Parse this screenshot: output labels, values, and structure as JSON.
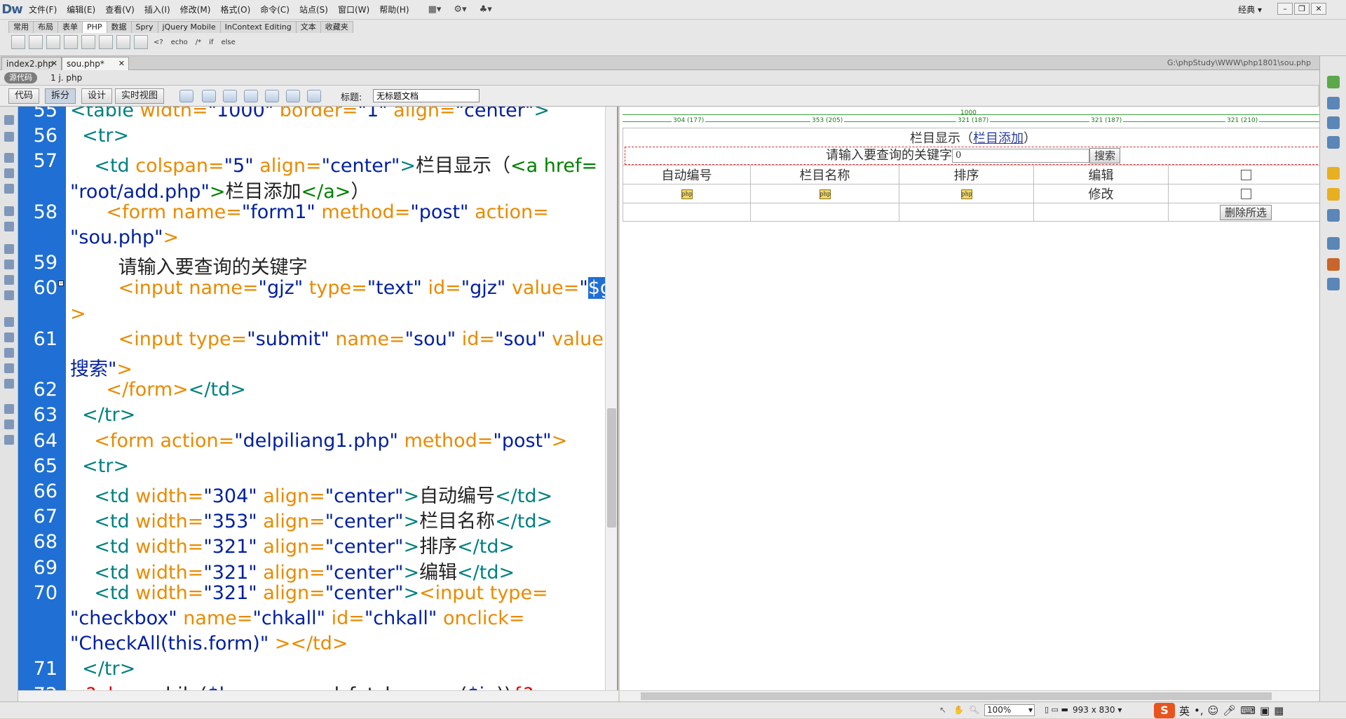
{
  "app": {
    "logo": "Dw",
    "layout_mode": "经典"
  },
  "menu": [
    "文件(F)",
    "编辑(E)",
    "查看(V)",
    "插入(I)",
    "修改(M)",
    "格式(O)",
    "命令(C)",
    "站点(S)",
    "窗口(W)",
    "帮助(H)"
  ],
  "insert_tabs": [
    "常用",
    "布局",
    "表单",
    "PHP",
    "数据",
    "Spry",
    "jQuery Mobile",
    "InContext Editing",
    "文本",
    "收藏夹"
  ],
  "insert_active_tab": "PHP",
  "insert_text_buttons": [
    "<?",
    "echo",
    "/*",
    "if",
    "else"
  ],
  "doc_tabs": [
    {
      "label": "index2.php"
    },
    {
      "label": "sou.php*"
    }
  ],
  "file_path": "G:\\phpStudy\\WWW\\php1801\\sou.php",
  "related": {
    "source_button": "源代码",
    "file": "1 j. php"
  },
  "view_buttons": [
    "代码",
    "拆分",
    "设计",
    "实时视图"
  ],
  "active_view": "拆分",
  "title_label": "标题:",
  "title_value": "无标题文档",
  "code_lines": [
    {
      "n": "55",
      "segs": [
        [
          "t",
          "<table "
        ],
        [
          "a",
          "width="
        ],
        [
          "s",
          "\"1000\" "
        ],
        [
          "a",
          "border="
        ],
        [
          "s",
          "\"1\" "
        ],
        [
          "a",
          "align="
        ],
        [
          "s",
          "\"center\""
        ],
        [
          "t",
          ">"
        ]
      ]
    },
    {
      "n": "56",
      "segs": [
        [
          "t",
          "  <tr>"
        ]
      ]
    },
    {
      "n": "57",
      "segs": [
        [
          "t",
          "    <td "
        ],
        [
          "a",
          "colspan="
        ],
        [
          "s",
          "\"5\" "
        ],
        [
          "a",
          "align="
        ],
        [
          "s",
          "\"center\""
        ],
        [
          "t",
          ">"
        ],
        [
          "txt",
          "栏目显示（"
        ],
        [
          "lnk",
          "<a href="
        ]
      ]
    },
    {
      "n": "",
      "segs": [
        [
          "s",
          "\"root/add.php\""
        ],
        [
          "lnk",
          ">"
        ],
        [
          "txt",
          "栏目添加"
        ],
        [
          "lnk",
          "</a>"
        ],
        [
          "txt",
          "）"
        ]
      ]
    },
    {
      "n": "58",
      "segs": [
        [
          "tf",
          "      <form "
        ],
        [
          "a",
          "name="
        ],
        [
          "s",
          "\"form1\" "
        ],
        [
          "a",
          "method="
        ],
        [
          "s",
          "\"post\" "
        ],
        [
          "a",
          "action="
        ]
      ]
    },
    {
      "n": "",
      "segs": [
        [
          "s",
          "\"sou.php\""
        ],
        [
          "tf",
          ">"
        ]
      ]
    },
    {
      "n": "59",
      "segs": [
        [
          "txt",
          "        请输入要查询的关键字"
        ]
      ]
    },
    {
      "n": "60",
      "segs": [
        [
          "tf",
          "        <input "
        ],
        [
          "a",
          "name="
        ],
        [
          "s",
          "\"gjz\" "
        ],
        [
          "a",
          "type="
        ],
        [
          "s",
          "\"text\" "
        ],
        [
          "a",
          "id="
        ],
        [
          "s",
          "\"gjz\" "
        ],
        [
          "a",
          "value="
        ],
        [
          "s",
          "\""
        ],
        [
          "hl",
          "$gjz"
        ],
        [
          "s",
          "\""
        ]
      ]
    },
    {
      "n": "",
      "segs": [
        [
          "tf",
          ">"
        ]
      ]
    },
    {
      "n": "61",
      "segs": [
        [
          "tf",
          "        <input "
        ],
        [
          "a",
          "type="
        ],
        [
          "s",
          "\"submit\" "
        ],
        [
          "a",
          "name="
        ],
        [
          "s",
          "\"sou\" "
        ],
        [
          "a",
          "id="
        ],
        [
          "s",
          "\"sou\" "
        ],
        [
          "a",
          "value="
        ],
        [
          "s",
          "\""
        ]
      ]
    },
    {
      "n": "",
      "segs": [
        [
          "s",
          "搜索\""
        ],
        [
          "tf",
          ">"
        ]
      ]
    },
    {
      "n": "62",
      "segs": [
        [
          "tf",
          "      </form>"
        ],
        [
          "t",
          "</td>"
        ]
      ]
    },
    {
      "n": "63",
      "segs": [
        [
          "t",
          "  </tr>"
        ]
      ]
    },
    {
      "n": "64",
      "segs": [
        [
          "tf",
          "    <form "
        ],
        [
          "a",
          "action="
        ],
        [
          "s",
          "\"delpiliang1.php\" "
        ],
        [
          "a",
          "method="
        ],
        [
          "s",
          "\"post\""
        ],
        [
          "tf",
          ">"
        ]
      ]
    },
    {
      "n": "65",
      "segs": [
        [
          "t",
          "  <tr>"
        ]
      ]
    },
    {
      "n": "66",
      "segs": [
        [
          "t",
          "    <td "
        ],
        [
          "a",
          "width="
        ],
        [
          "s",
          "\"304\" "
        ],
        [
          "a",
          "align="
        ],
        [
          "s",
          "\"center\""
        ],
        [
          "t",
          ">"
        ],
        [
          "txt",
          "自动编号"
        ],
        [
          "t",
          "</td>"
        ]
      ]
    },
    {
      "n": "67",
      "segs": [
        [
          "t",
          "    <td "
        ],
        [
          "a",
          "width="
        ],
        [
          "s",
          "\"353\" "
        ],
        [
          "a",
          "align="
        ],
        [
          "s",
          "\"center\""
        ],
        [
          "t",
          ">"
        ],
        [
          "txt",
          "栏目名称"
        ],
        [
          "t",
          "</td>"
        ]
      ]
    },
    {
      "n": "68",
      "segs": [
        [
          "t",
          "    <td "
        ],
        [
          "a",
          "width="
        ],
        [
          "s",
          "\"321\" "
        ],
        [
          "a",
          "align="
        ],
        [
          "s",
          "\"center\""
        ],
        [
          "t",
          ">"
        ],
        [
          "txt",
          "排序"
        ],
        [
          "t",
          "</td>"
        ]
      ]
    },
    {
      "n": "69",
      "segs": [
        [
          "t",
          "    <td "
        ],
        [
          "a",
          "width="
        ],
        [
          "s",
          "\"321\" "
        ],
        [
          "a",
          "align="
        ],
        [
          "s",
          "\"center\""
        ],
        [
          "t",
          ">"
        ],
        [
          "txt",
          "编辑"
        ],
        [
          "t",
          "</td>"
        ]
      ]
    },
    {
      "n": "70",
      "segs": [
        [
          "t",
          "    <td "
        ],
        [
          "a",
          "width="
        ],
        [
          "s",
          "\"321\" "
        ],
        [
          "a",
          "align="
        ],
        [
          "s",
          "\"center\""
        ],
        [
          "t",
          ">"
        ],
        [
          "tf",
          "<input "
        ],
        [
          "a",
          "type="
        ]
      ]
    },
    {
      "n": "",
      "segs": [
        [
          "s",
          "\"checkbox\" "
        ],
        [
          "a",
          "name="
        ],
        [
          "s",
          "\"chkall\" "
        ],
        [
          "a",
          "id="
        ],
        [
          "s",
          "\"chkall\" "
        ],
        [
          "a",
          "onclick="
        ]
      ]
    },
    {
      "n": "",
      "segs": [
        [
          "s",
          "\"CheckAll(this.form)\" "
        ],
        [
          "tf",
          "></td>"
        ]
      ]
    },
    {
      "n": "71",
      "segs": [
        [
          "t",
          "  </tr>"
        ]
      ]
    },
    {
      "n": "72",
      "segs": [
        [
          "php",
          "<?php "
        ],
        [
          "txt",
          "  while("
        ],
        [
          "s",
          "$hang"
        ],
        [
          "txt",
          "=mysql_fetch_assoc("
        ],
        [
          "s",
          "$jg"
        ],
        [
          "txt",
          "))"
        ],
        [
          "php",
          "{?>"
        ]
      ]
    }
  ],
  "ruler": {
    "total": "1000",
    "cols": [
      "304 (177)",
      "353 (205)",
      "321 (187)",
      "321 (187)",
      "321 (210)"
    ]
  },
  "preview": {
    "title_text": "栏目显示（",
    "title_link": "栏目添加",
    "title_end": "）",
    "search_label": "请输入要查询的关键字",
    "search_value": "0",
    "search_button": "搜索",
    "headers": [
      "自动编号",
      "栏目名称",
      "排序",
      "编辑"
    ],
    "php_marker": "php",
    "edit_link": "修改",
    "delete_button": "删除所选"
  },
  "status": {
    "zoom": "100%",
    "dimensions": "993 x 830",
    "ime_logo": "S",
    "ime_lang": "英"
  }
}
